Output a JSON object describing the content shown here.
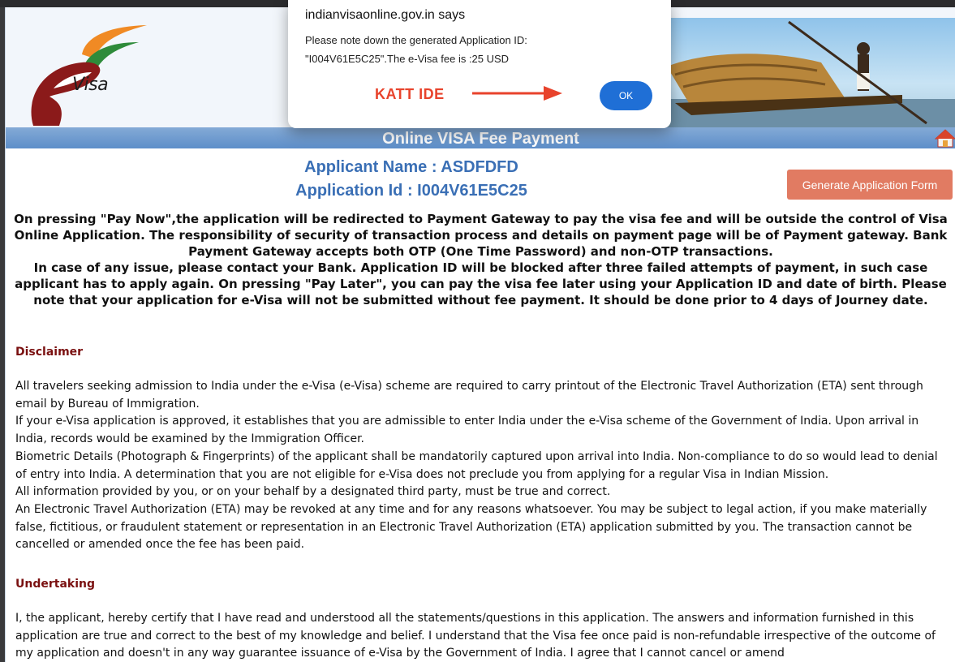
{
  "dialog": {
    "title": "indianvisaonline.gov.in says",
    "message_line1": "Please note down the generated Application ID:",
    "message_line2": "\"I004V61E5C25\".The e-Visa fee is :25 USD",
    "ok_label": "OK",
    "annotation": "KATT IDE",
    "annotation_color": "#e8432c",
    "ok_color": "#1f6fd6"
  },
  "header": {
    "logo_text": "Visa",
    "title": "Online VISA Fee Payment"
  },
  "applicant": {
    "name_line": "Applicant Name : ASDFDFD",
    "id_line": "Application Id : I004V61E5C25"
  },
  "buttons": {
    "generate": "Generate Application Form"
  },
  "notice": {
    "p1": "On pressing \"Pay Now\",the application will be redirected to Payment Gateway to pay the visa fee and will be outside the control of Visa Online Application. The responsibility of security of transaction process and details on payment page will be of Payment gateway. Bank Payment Gateway accepts both OTP (One Time Password) and non-OTP transactions.",
    "p2": "In case of any issue, please contact your Bank. Application ID will be blocked after three failed attempts of payment, in such case applicant has to apply again. On pressing \"Pay Later\", you can pay the visa fee later using your Application ID and date of birth. Please note that your application for e-Visa will not be submitted without fee payment. It should be done prior to 4 days of Journey date."
  },
  "disclaimer": {
    "title": "Disclaimer",
    "paragraphs": [
      "All travelers seeking admission to India under the e-Visa (e-Visa) scheme are required to carry printout of the Electronic Travel Authorization (ETA) sent through email by Bureau of Immigration.",
      "If your e-Visa application is approved, it establishes that you are admissible to enter India under the e-Visa scheme of the Government of India. Upon arrival in India, records would be examined by the Immigration Officer.",
      "Biometric Details (Photograph & Fingerprints) of the applicant shall be mandatorily captured upon arrival into India. Non-compliance to do so would lead to denial of entry into India. A determination that you are not eligible for e-Visa does not preclude you from applying for a regular Visa in Indian Mission.",
      "All information provided by you, or on your behalf by a designated third party, must be true and correct.",
      "An Electronic Travel Authorization (ETA) may be revoked at any time and for any reasons whatsoever. You may be subject to legal action, if you make materially false, fictitious, or fraudulent statement or representation in an Electronic Travel Authorization (ETA) application submitted by you. The transaction cannot be cancelled or amended once the fee has been paid."
    ]
  },
  "undertaking": {
    "title": "Undertaking",
    "text": "I, the applicant, hereby certify that I have read and understood all the statements/questions in this application. The answers and information furnished in this application are true and correct to the best of my knowledge and belief. I understand that the Visa fee once paid is non-refundable irrespective of the outcome of my application and doesn't in any way guarantee issuance of e-Visa by the Government of India. I agree that I cannot cancel or amend"
  },
  "icons": {
    "home": "home-icon",
    "logo": "evisa-logo-icon",
    "arrow": "arrow-right-icon"
  },
  "colors": {
    "title_bar": "#5d8ec9",
    "applicant_text": "#3a6fb5",
    "generate_button": "#e17b62",
    "section_title": "#7a1010"
  }
}
